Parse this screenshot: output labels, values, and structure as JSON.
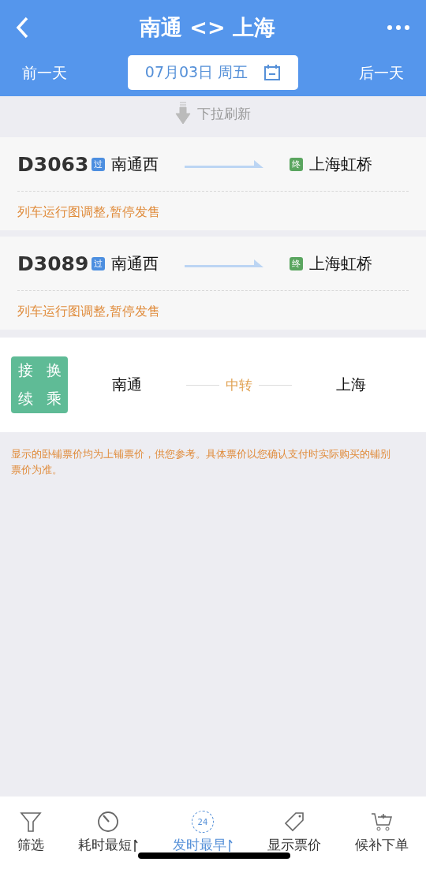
{
  "header": {
    "title": "南通 <> 上海",
    "prev_day": "前一天",
    "date": "07月03日 周五",
    "next_day": "后一天"
  },
  "pull_hint": "下拉刷新",
  "trains": [
    {
      "number": "D3063",
      "from_badge": "过",
      "from": "南通西",
      "to_badge": "终",
      "to": "上海虹桥",
      "notice": "列车运行图调整,暂停发售"
    },
    {
      "number": "D3089",
      "from_badge": "过",
      "from": "南通西",
      "to_badge": "终",
      "to": "上海虹桥",
      "notice": "列车运行图调整,暂停发售"
    }
  ],
  "transfer": {
    "badge": [
      "接",
      "换",
      "续",
      "乘"
    ],
    "from": "南通",
    "via": "中转",
    "to": "上海"
  },
  "note": "显示的卧铺票价均为上铺票价，供您参考。具体票价以您确认支付时实际购买的铺别票价为准。",
  "bottom_tabs": [
    {
      "kind": "filter",
      "label": "筛选",
      "selected": false,
      "sort": false
    },
    {
      "kind": "timer",
      "label": "耗时最短",
      "selected": false,
      "sort": true
    },
    {
      "kind": "clock",
      "icon_text": "24",
      "label": "发时最早",
      "selected": true,
      "sort": true
    },
    {
      "kind": "tag",
      "label": "显示票价",
      "selected": false,
      "sort": false
    },
    {
      "kind": "cart",
      "label": "候补下单",
      "selected": false,
      "sort": false
    }
  ]
}
